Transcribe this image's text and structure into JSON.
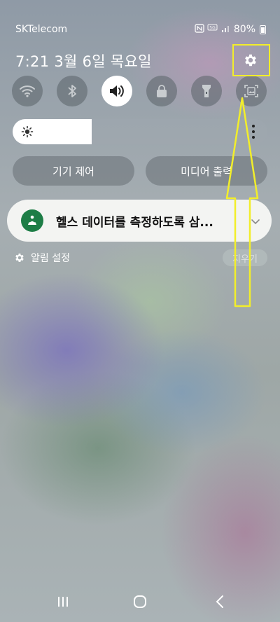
{
  "status_bar": {
    "carrier": "SKTelecom",
    "battery_text": "80%",
    "icons": [
      "nfc-icon",
      "5g-icon",
      "signal-icon",
      "battery-icon"
    ]
  },
  "header": {
    "datetime": "7:21  3월 6일 목요일"
  },
  "quick_toggles": [
    {
      "name": "wifi",
      "icon": "wifi-icon",
      "on": false
    },
    {
      "name": "bluetooth",
      "icon": "bluetooth-icon",
      "on": false
    },
    {
      "name": "sound",
      "icon": "speaker-icon",
      "on": true
    },
    {
      "name": "lock",
      "icon": "lock-icon",
      "on": false
    },
    {
      "name": "flashlight",
      "icon": "flashlight-icon",
      "on": false
    },
    {
      "name": "screen-capture",
      "icon": "screen-capture-icon",
      "on": false
    }
  ],
  "brightness": {
    "level_fraction": 0.31
  },
  "pills": {
    "device_control": "기기 제어",
    "media_output": "미디어 출력"
  },
  "notification": {
    "text": "헬스 데이터를 측정하도록 삼...",
    "icon": "health-app-icon",
    "icon_color": "#1d7d46"
  },
  "notification_settings": {
    "label": "알림 설정",
    "clear_label": "지우기"
  },
  "annotation": {
    "color": "#f2ee2a"
  }
}
